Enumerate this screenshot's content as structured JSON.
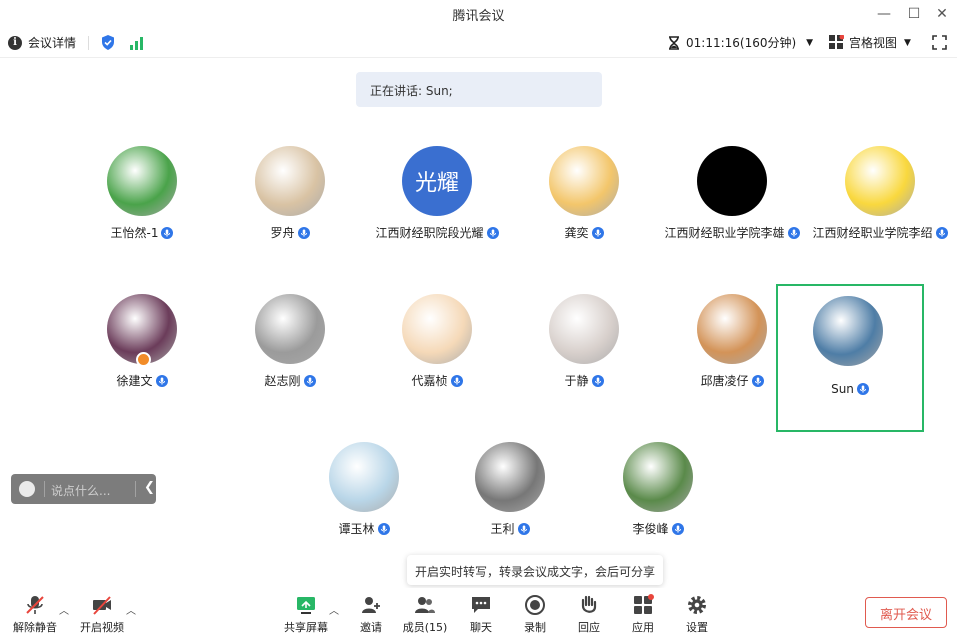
{
  "window": {
    "title": "腾讯会议"
  },
  "infobar": {
    "meeting_details": "会议详情",
    "timer": "01:11:16(160分钟)",
    "view_mode": "宫格视图"
  },
  "speaking": {
    "text": "正在讲话: Sun;"
  },
  "participants": [
    {
      "name": "王怡然-1",
      "avatar": "green-glass-avatar",
      "color": "#4aa34a"
    },
    {
      "name": "罗舟",
      "avatar": "cartoon-girls-avatar",
      "color": "#d9c3a4"
    },
    {
      "name": "江西财经职院段光耀",
      "avatar": "text-avatar",
      "avatar_text": "光耀",
      "color": "#3a6fd0"
    },
    {
      "name": "龚奕",
      "avatar": "lion-cartoon-avatar",
      "color": "#f3c66b"
    },
    {
      "name": "江西财经职业学院李雄",
      "avatar": "black-avatar",
      "color": "#000000"
    },
    {
      "name": "江西财经职业学院李绍",
      "avatar": "pikachu-avatar",
      "color": "#f9d83e"
    },
    {
      "name": "徐建文",
      "avatar": "sunset-photo-avatar",
      "color": "#6b3c5a"
    },
    {
      "name": "赵志刚",
      "avatar": "sketch-avatar",
      "color": "#9b9b9b"
    },
    {
      "name": "代嘉桢",
      "avatar": "crayon-boy-avatar",
      "color": "#f5d9b8"
    },
    {
      "name": "于静",
      "avatar": "kitten-avatar",
      "color": "#d8d0cc"
    },
    {
      "name": "邱唐凌仔",
      "avatar": "shiba-dog-avatar",
      "color": "#d39358"
    },
    {
      "name": "Sun",
      "avatar": "aerial-city-avatar",
      "color": "#4e7da6"
    },
    {
      "name": "谭玉林",
      "avatar": "stacked-stones-avatar",
      "color": "#b9d6e8"
    },
    {
      "name": "王利",
      "avatar": "bw-landscape-avatar",
      "color": "#777777"
    },
    {
      "name": "李俊峰",
      "avatar": "mountain-photo-avatar",
      "color": "#5a8a4a"
    }
  ],
  "chat": {
    "placeholder": "说点什么..."
  },
  "tip": {
    "text": "开启实时转写，转录会议成文字，会后可分享"
  },
  "toolbar": {
    "unmute": "解除静音",
    "start_video": "开启视频",
    "share_screen": "共享屏幕",
    "invite": "邀请",
    "members": "成员(15)",
    "chat": "聊天",
    "record": "录制",
    "react": "回应",
    "apps": "应用",
    "settings": "设置",
    "leave": "离开会议"
  },
  "colors": {
    "accent": "#2f76e8",
    "active_border": "#28b766",
    "leave": "#e05a4f",
    "share": "#28b766"
  }
}
